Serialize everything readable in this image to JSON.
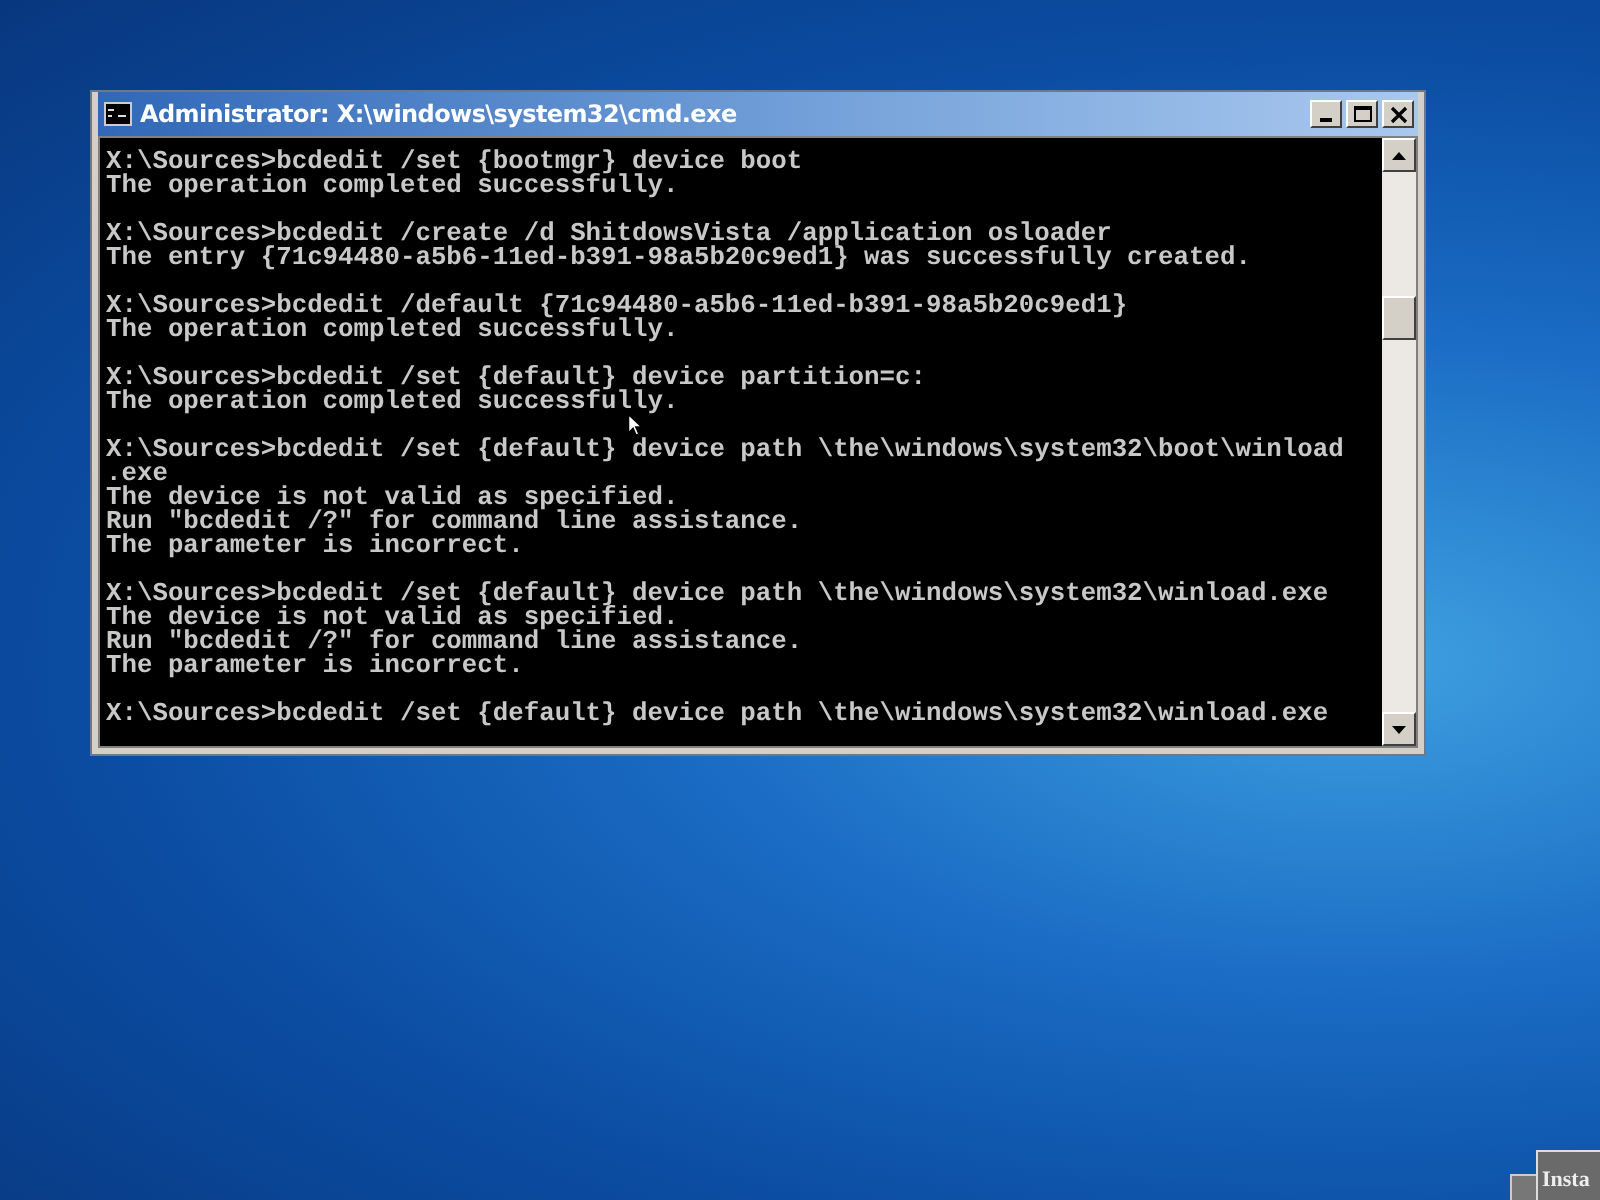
{
  "window": {
    "title": "Administrator: X:\\windows\\system32\\cmd.exe"
  },
  "console": {
    "blocks": [
      {
        "lines": [
          "X:\\Sources>bcdedit /set {bootmgr} device boot",
          "The operation completed successfully."
        ]
      },
      {
        "lines": [
          "X:\\Sources>bcdedit /create /d ShitdowsVista /application osloader",
          "The entry {71c94480-a5b6-11ed-b391-98a5b20c9ed1} was successfully created."
        ]
      },
      {
        "lines": [
          "X:\\Sources>bcdedit /default {71c94480-a5b6-11ed-b391-98a5b20c9ed1}",
          "The operation completed successfully."
        ]
      },
      {
        "lines": [
          "X:\\Sources>bcdedit /set {default} device partition=c:",
          "The operation completed successfully."
        ]
      },
      {
        "lines": [
          "X:\\Sources>bcdedit /set {default} device path \\the\\windows\\system32\\boot\\winload",
          ".exe",
          "The device is not valid as specified.",
          "Run \"bcdedit /?\" for command line assistance.",
          "The parameter is incorrect."
        ]
      },
      {
        "lines": [
          "X:\\Sources>bcdedit /set {default} device path \\the\\windows\\system32\\winload.exe",
          "The device is not valid as specified.",
          "Run \"bcdedit /?\" for command line assistance.",
          "The parameter is incorrect."
        ]
      },
      {
        "lines": [
          "X:\\Sources>bcdedit /set {default} device path \\the\\windows\\system32\\winload.exe"
        ]
      }
    ]
  },
  "background_window": {
    "title": "Insta"
  }
}
